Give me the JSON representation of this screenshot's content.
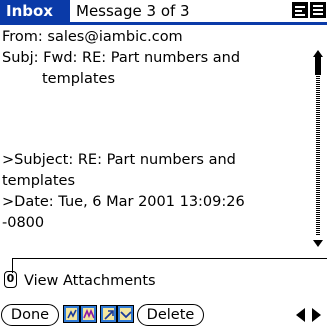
{
  "header": {
    "app_tab": "Inbox",
    "message_position": "Message 3 of 3",
    "icons": [
      "menu-bar-icon",
      "list-view-icon"
    ]
  },
  "message": {
    "from_line": "From: sales@iambic.com",
    "subject_line1": "Subj: Fwd: RE: Part numbers and",
    "subject_line2": "templates",
    "quoted_subject_line1": ">Subject: RE: Part numbers and",
    "quoted_subject_line2": "templates",
    "quoted_date_line1": ">Date: Tue, 6 Mar 2001 13:09:26",
    "quoted_date_line2": "-0800"
  },
  "attachments": {
    "clip_glyph": "0",
    "label": "View Attachments"
  },
  "toolbar": {
    "done_label": "Done",
    "delete_label": "Delete",
    "icons": [
      "previous-unread-icon",
      "next-unread-icon",
      "reply-icon",
      "mark-icon"
    ],
    "nav_icons": [
      "previous-message-icon",
      "next-message-icon"
    ]
  },
  "colors": {
    "accent": "#0a3aa8",
    "toolbar_icon_blue": "#2f7ad6",
    "toolbar_icon_fill": "#f3e6a0"
  }
}
